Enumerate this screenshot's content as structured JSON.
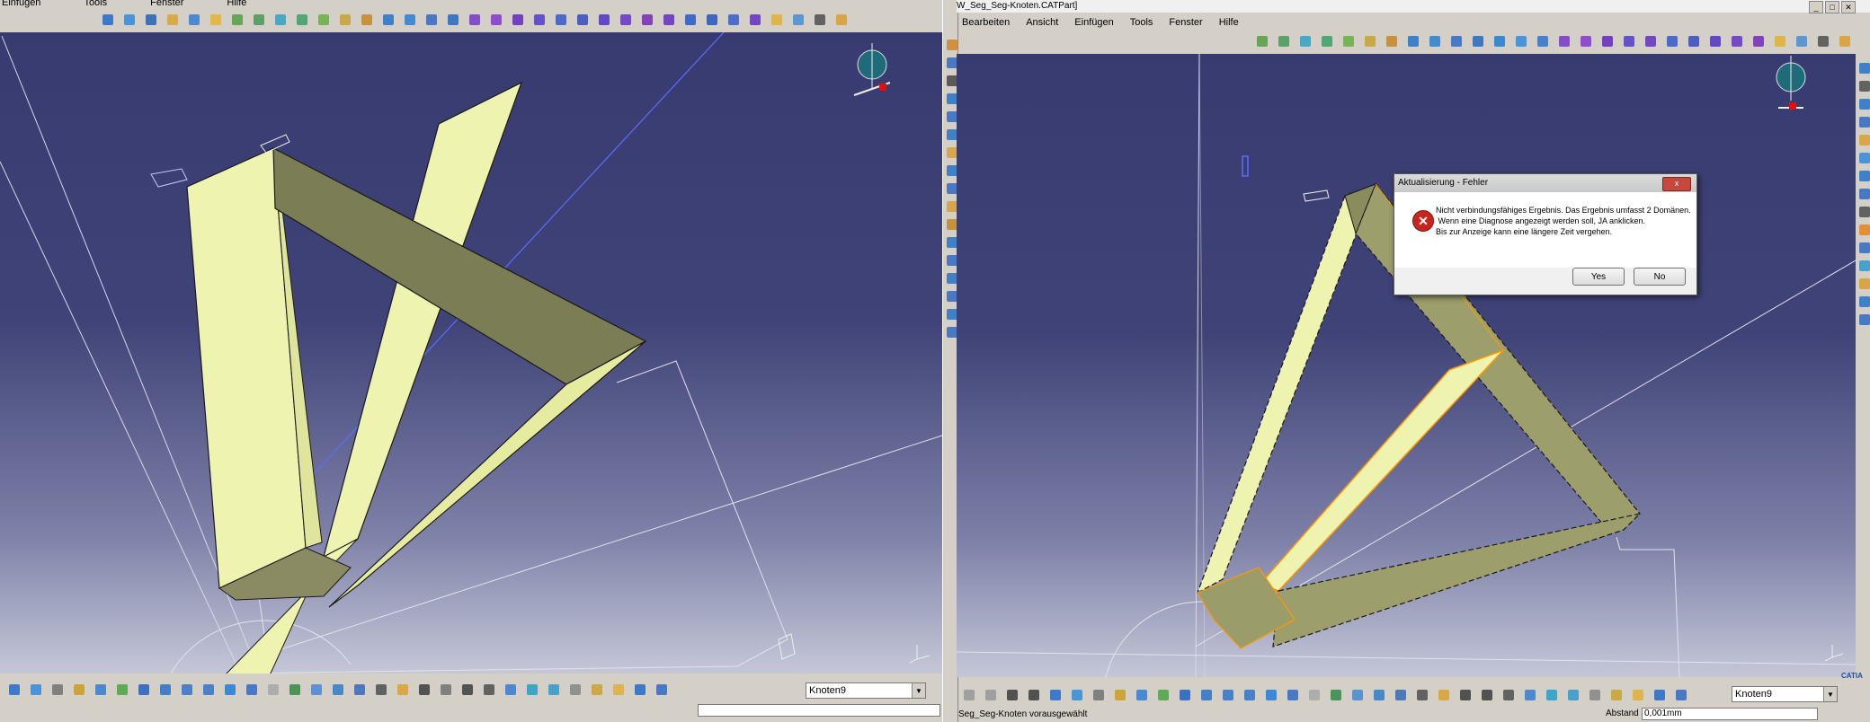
{
  "left_window": {
    "menu": [
      "Einfügen",
      "Tools",
      "Fenster",
      "Hilfe"
    ],
    "current_object": "Knoten9"
  },
  "right_window": {
    "title": "W_Seg_Seg-Knoten.CATPart]",
    "menu": [
      "Bearbeiten",
      "Ansicht",
      "Einfügen",
      "Tools",
      "Fenster",
      "Hilfe"
    ],
    "current_object": "Knoten9",
    "status_text": "Seg_Seg-Knoten vorausgewählt",
    "distance_label": "Abstand",
    "distance_value": "0,001mm"
  },
  "dialog": {
    "title": "Aktualisierung - Fehler",
    "message": [
      "Nicht verbindungsfähiges Ergebnis. Das Ergebnis umfasst 2 Domänen.",
      " Wenn eine Diagnose angezeigt werden soll, JA anklicken.",
      "Bis zur Anzeige kann eine längere Zeit vergehen."
    ],
    "yes_label": "Yes",
    "no_label": "No",
    "icon": "error-icon"
  },
  "logo_text": "CATIA",
  "colors": {
    "viewport_top": "#383b6f",
    "solid_light": "#eef3b0",
    "solid_dark": "#7b7d55",
    "edge_highlight": "#ff9900",
    "error_red": "#c8261c"
  }
}
